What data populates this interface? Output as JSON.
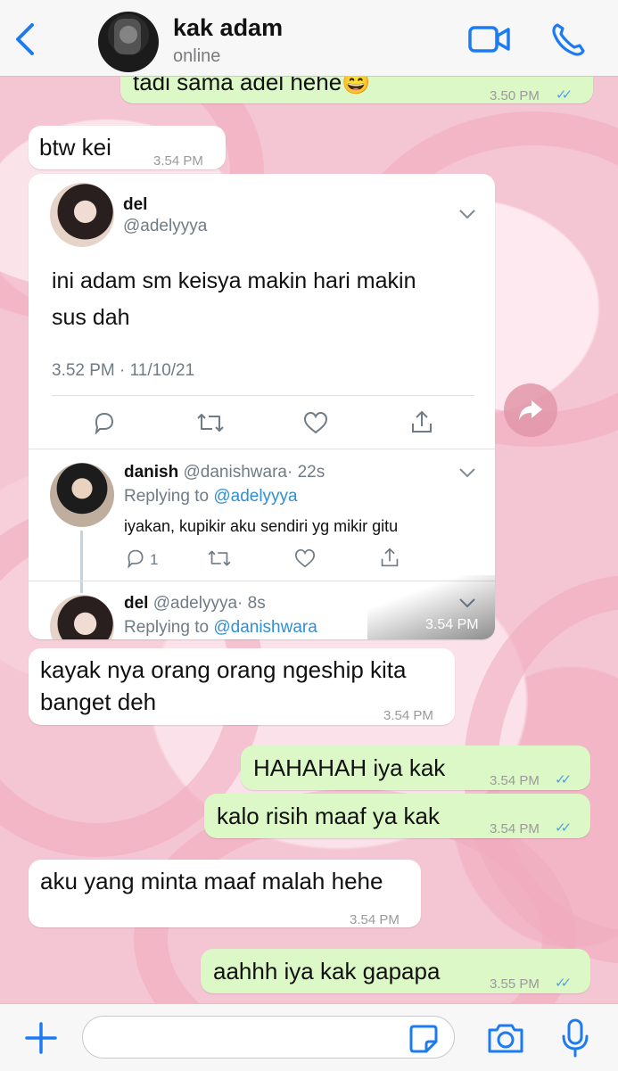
{
  "header": {
    "contact_name": "kak adam",
    "status": "online"
  },
  "messages": [
    {
      "id": "m0",
      "dir": "out",
      "text": "tadi sama adel hehe",
      "emoji": "😄",
      "time": "3.50 PM",
      "read": true
    },
    {
      "id": "m1",
      "dir": "in",
      "text": "btw kei",
      "time": "3.54 PM"
    },
    {
      "id": "m3",
      "dir": "in",
      "text": "kayak nya orang orang ngeship kita\nbanget deh",
      "time": "3.54 PM"
    },
    {
      "id": "m4",
      "dir": "out",
      "text": "HAHAHAH iya kak",
      "time": "3.54 PM",
      "read": true
    },
    {
      "id": "m5",
      "dir": "out",
      "text": "kalo risih maaf ya kak",
      "time": "3.54 PM",
      "read": true
    },
    {
      "id": "m6",
      "dir": "in",
      "text": "aku yang minta maaf malah hehe",
      "time": "3.54 PM"
    },
    {
      "id": "m7",
      "dir": "out",
      "text": "aahhh iya kak gapapa",
      "time": "3.55 PM",
      "read": true
    }
  ],
  "tweet": {
    "name": "del",
    "handle": "@adelyyya",
    "text": "ini adam sm keisya makin hari makin\nsus dah",
    "meta": "3.52 PM · 11/10/21",
    "time": "3.54 PM",
    "replies": [
      {
        "name": "danish",
        "handle": "@danishwara",
        "age": "· 22s",
        "replying_prefix": "Replying to ",
        "replying_to": "@adelyyya",
        "text": "iyakan, kupikir aku sendiri yg mikir gitu",
        "reply_count": "1"
      },
      {
        "name": "del",
        "handle": "@adelyyya",
        "age": "· 8s",
        "replying_prefix": "Replying to ",
        "replying_to": "@danishwara"
      }
    ]
  },
  "input": {
    "placeholder": ""
  },
  "colors": {
    "accent": "#1d7bf2",
    "outgoing": "#dcf8c6",
    "incoming": "#ffffff",
    "read_ticks": "#4fa3e3"
  }
}
